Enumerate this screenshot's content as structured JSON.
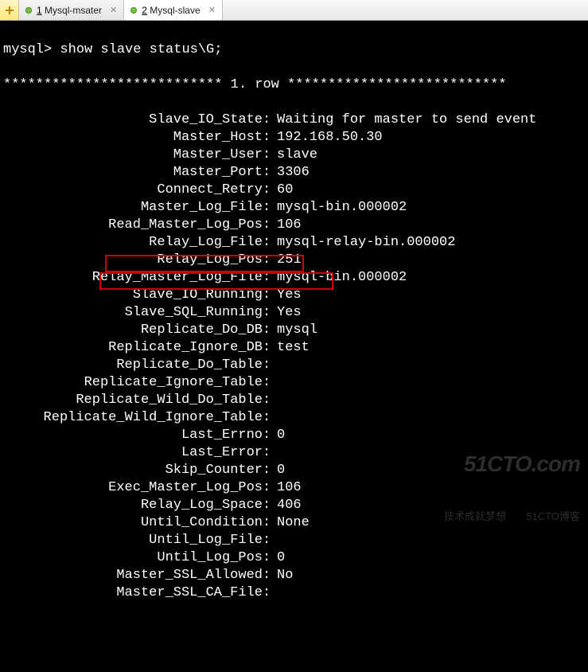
{
  "tabs": [
    {
      "index": "1",
      "label": "Mysql-msater",
      "active": false
    },
    {
      "index": "2",
      "label": "Mysql-slave",
      "active": true
    }
  ],
  "prompt": "mysql> ",
  "command": "show slave status\\G;",
  "row_header_prefix": "*************************** ",
  "row_header_num": "1.",
  "row_header_word": " row ",
  "row_header_suffix": "***************************",
  "fields": [
    {
      "key": "Slave_IO_State",
      "val": "Waiting for master to send event"
    },
    {
      "key": "Master_Host",
      "val": "192.168.50.30"
    },
    {
      "key": "Master_User",
      "val": "slave"
    },
    {
      "key": "Master_Port",
      "val": "3306"
    },
    {
      "key": "Connect_Retry",
      "val": "60"
    },
    {
      "key": "Master_Log_File",
      "val": "mysql-bin.000002"
    },
    {
      "key": "Read_Master_Log_Pos",
      "val": "106"
    },
    {
      "key": "Relay_Log_File",
      "val": "mysql-relay-bin.000002"
    },
    {
      "key": "Relay_Log_Pos",
      "val": "251"
    },
    {
      "key": "Relay_Master_Log_File",
      "val": "mysql-bin.000002"
    },
    {
      "key": "Slave_IO_Running",
      "val": "Yes"
    },
    {
      "key": "Slave_SQL_Running",
      "val": "Yes"
    },
    {
      "key": "Replicate_Do_DB",
      "val": "mysql"
    },
    {
      "key": "Replicate_Ignore_DB",
      "val": "test"
    },
    {
      "key": "Replicate_Do_Table",
      "val": ""
    },
    {
      "key": "Replicate_Ignore_Table",
      "val": ""
    },
    {
      "key": "Replicate_Wild_Do_Table",
      "val": ""
    },
    {
      "key": "Replicate_Wild_Ignore_Table",
      "val": ""
    },
    {
      "key": "Last_Errno",
      "val": "0"
    },
    {
      "key": "Last_Error",
      "val": ""
    },
    {
      "key": "Skip_Counter",
      "val": "0"
    },
    {
      "key": "Exec_Master_Log_Pos",
      "val": "106"
    },
    {
      "key": "Relay_Log_Space",
      "val": "406"
    },
    {
      "key": "Until_Condition",
      "val": "None"
    },
    {
      "key": "Until_Log_File",
      "val": ""
    },
    {
      "key": "Until_Log_Pos",
      "val": "0"
    },
    {
      "key": "Master_SSL_Allowed",
      "val": "No"
    },
    {
      "key": "Master_SSL_CA_File",
      "val": ""
    }
  ],
  "watermark": {
    "line1": "51CTO.com",
    "line2": "技术成就梦想       51CTO博客"
  }
}
